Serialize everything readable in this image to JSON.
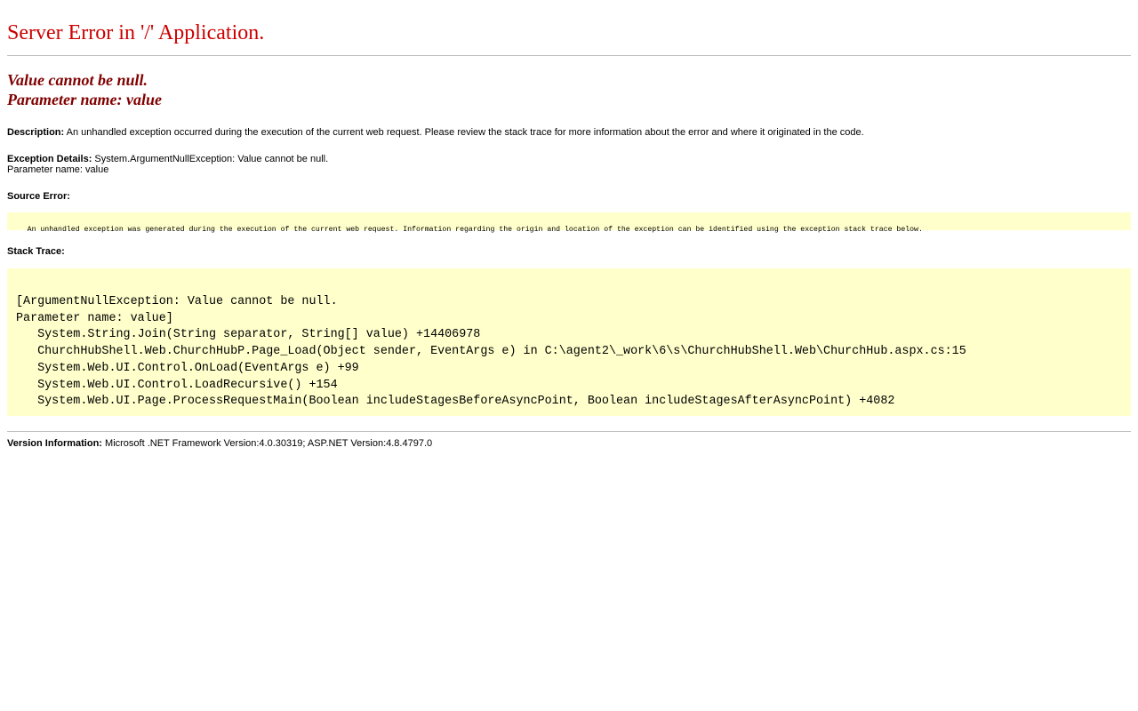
{
  "page": {
    "title": "Server Error in '/' Application.",
    "message_line1": "Value cannot be null.",
    "message_line2": "Parameter name: value"
  },
  "description": {
    "label": "Description:",
    "text": "An unhandled exception occurred during the execution of the current web request. Please review the stack trace for more information about the error and where it originated in the code."
  },
  "exception": {
    "label": "Exception Details:",
    "text": "System.ArgumentNullException: Value cannot be null.",
    "text_line2": "Parameter name: value"
  },
  "source_error": {
    "label": "Source Error:",
    "text": "An unhandled exception was generated during the execution of the current web request. Information regarding the origin and location of the exception can be identified using the exception stack trace below."
  },
  "stack_trace": {
    "label": "Stack Trace:",
    "lines": [
      "[ArgumentNullException: Value cannot be null.",
      "Parameter name: value]",
      "   System.String.Join(String separator, String[] value) +14406978",
      "   ChurchHubShell.Web.ChurchHubP.Page_Load(Object sender, EventArgs e) in C:\\agent2\\_work\\6\\s\\ChurchHubShell.Web\\ChurchHub.aspx.cs:15",
      "   System.Web.UI.Control.OnLoad(EventArgs e) +99",
      "   System.Web.UI.Control.LoadRecursive() +154",
      "   System.Web.UI.Page.ProcessRequestMain(Boolean includeStagesBeforeAsyncPoint, Boolean includeStagesAfterAsyncPoint) +4082"
    ]
  },
  "version": {
    "label": "Version Information:",
    "text": "Microsoft .NET Framework Version:4.0.30319; ASP.NET Version:4.8.4797.0"
  },
  "colors": {
    "title": "#cc0000",
    "subtitle": "#800000",
    "code_background": "#ffffcc",
    "rule": "#c0c0c0"
  }
}
